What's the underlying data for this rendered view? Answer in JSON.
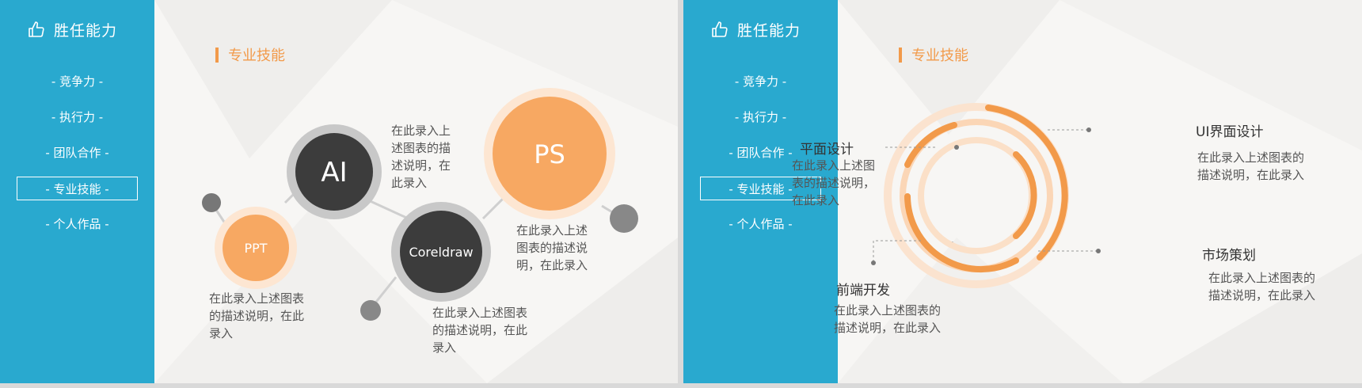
{
  "slides": [
    {
      "sidebar": {
        "title": "胜任能力",
        "menu": [
          "- 竞争力 -",
          "- 执行力 -",
          "- 团队合作 -",
          "- 专业技能 -",
          "- 个人作品 -"
        ],
        "active_index": 3
      },
      "section_title": "专业技能",
      "bubbles": {
        "ai": "AI",
        "ppt": "PPT",
        "ps": "PS",
        "coreldraw": "Coreldraw"
      },
      "descriptions": {
        "ai": [
          "在此录入上",
          "述图表的描",
          "述说明，在",
          "此录入"
        ],
        "ps": [
          "在此录入上述",
          "图表的描述说",
          "明，在此录入"
        ],
        "ppt": [
          "在此录入上述图表",
          "的描述说明，在此",
          "录入"
        ],
        "coreldraw": [
          "在此录入上述图表",
          "的描述说明，在此",
          "录入"
        ]
      }
    },
    {
      "sidebar": {
        "title": "胜任能力",
        "menu": [
          "- 竞争力 -",
          "- 执行力 -",
          "- 团队合作 -",
          "- 专业技能 -",
          "- 个人作品 -"
        ],
        "active_index": 3
      },
      "section_title": "专业技能",
      "items": {
        "planar": {
          "label": "平面设计",
          "desc": [
            "在此录入上述图",
            "表的描述说明，",
            "在此录入"
          ]
        },
        "ui": {
          "label": "UI界面设计",
          "desc": [
            "在此录入上述图表的",
            "描述说明，在此录入"
          ]
        },
        "market": {
          "label": "市场策划",
          "desc": [
            "在此录入上述图表的",
            "描述说明，在此录入"
          ]
        },
        "frontend": {
          "label": "前端开发",
          "desc": [
            "在此录入上述图表的",
            "描述说明，在此录入"
          ]
        }
      }
    }
  ],
  "colors": {
    "sidebar": "#29a9cf",
    "accent": "#f29a4a",
    "dark_bubble": "#3c3c3c",
    "orange_bubble": "#f7a862"
  }
}
